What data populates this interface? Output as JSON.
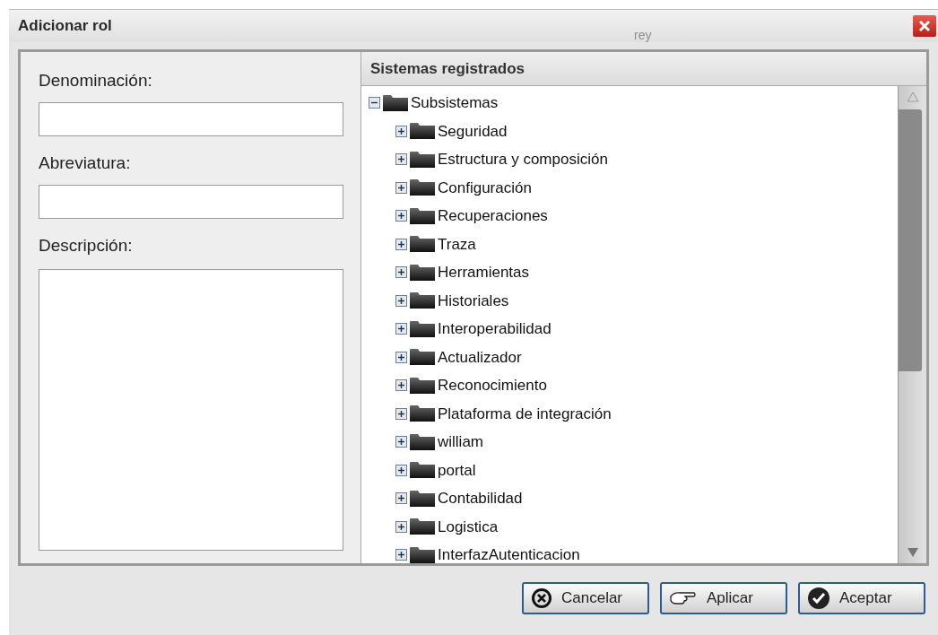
{
  "window": {
    "title": "Adicionar rol",
    "background_text": "rey"
  },
  "form": {
    "fields": [
      {
        "label": "Denominación:",
        "kind": "input"
      },
      {
        "label": "Abreviatura:",
        "kind": "input"
      },
      {
        "label": "Descripción:",
        "kind": "textarea"
      }
    ]
  },
  "systems_panel": {
    "title": "Sistemas registrados",
    "tree": [
      {
        "label": "Subsistemas",
        "expanded": true,
        "children": [
          {
            "label": "Seguridad",
            "expanded": false
          },
          {
            "label": "Estructura y composición",
            "expanded": false
          },
          {
            "label": "Configuración",
            "expanded": false
          },
          {
            "label": "Recuperaciones",
            "expanded": false
          },
          {
            "label": "Traza",
            "expanded": false
          },
          {
            "label": "Herramientas",
            "expanded": false
          },
          {
            "label": "Historiales",
            "expanded": false
          },
          {
            "label": "Interoperabilidad",
            "expanded": false
          },
          {
            "label": "Actualizador",
            "expanded": false
          },
          {
            "label": "Reconocimiento",
            "expanded": false
          },
          {
            "label": "Plataforma de integración",
            "expanded": false
          },
          {
            "label": "william",
            "expanded": false
          },
          {
            "label": "portal",
            "expanded": false
          },
          {
            "label": "Contabilidad",
            "expanded": false
          },
          {
            "label": "Logistica",
            "expanded": false
          },
          {
            "label": "InterfazAutenticacion",
            "expanded": false
          }
        ]
      }
    ]
  },
  "buttons": [
    {
      "label": "Cancelar",
      "kind": "cancel"
    },
    {
      "label": "Aplicar",
      "kind": "apply"
    },
    {
      "label": "Aceptar",
      "kind": "accept"
    }
  ]
}
